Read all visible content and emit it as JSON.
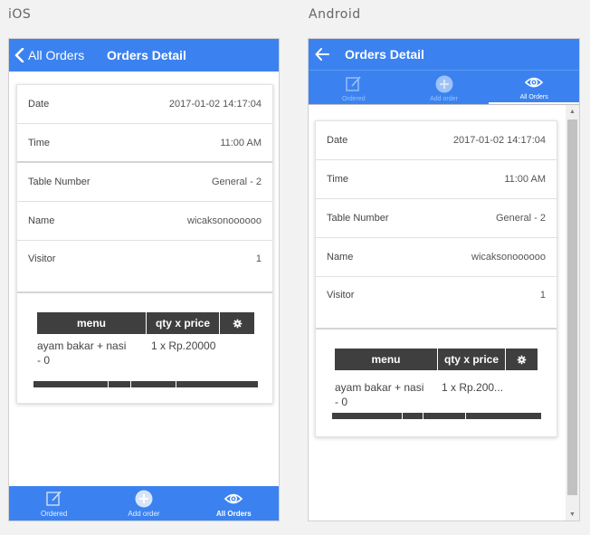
{
  "labels": {
    "ios": "iOS",
    "android": "Android"
  },
  "ios": {
    "back_label": "All Orders",
    "title": "Orders Detail"
  },
  "android": {
    "title": "Orders Detail"
  },
  "details": {
    "date_label": "Date",
    "date_value": "2017-01-02 14:17:04",
    "time_label": "Time",
    "time_value": "11:00 AM",
    "table_label": "Table Number",
    "table_value": "General - 2",
    "name_label": "Name",
    "name_value": "wicaksonoooooo",
    "visitor_label": "Visitor",
    "visitor_value": "1"
  },
  "order_table": {
    "headers": [
      "menu",
      "qty x price"
    ],
    "ios_row": {
      "menu_line1": "ayam bakar + nasi",
      "menu_line2": "- 0",
      "qty_price": "1 x Rp.20000"
    },
    "android_row": {
      "menu_line1": "ayam bakar + nasi",
      "menu_line2": "- 0",
      "qty_price": "1 x Rp.200..."
    }
  },
  "tabs": {
    "ordered": "Ordered",
    "add_order": "Add order",
    "all_orders": "All Orders"
  },
  "icons": [
    "chevron-left-icon",
    "arrow-left-icon",
    "edit-icon",
    "plus-circle-icon",
    "eye-icon",
    "gear-icon"
  ],
  "colors": {
    "accent": "#3b82f0",
    "table_header": "#3f3f3f"
  }
}
